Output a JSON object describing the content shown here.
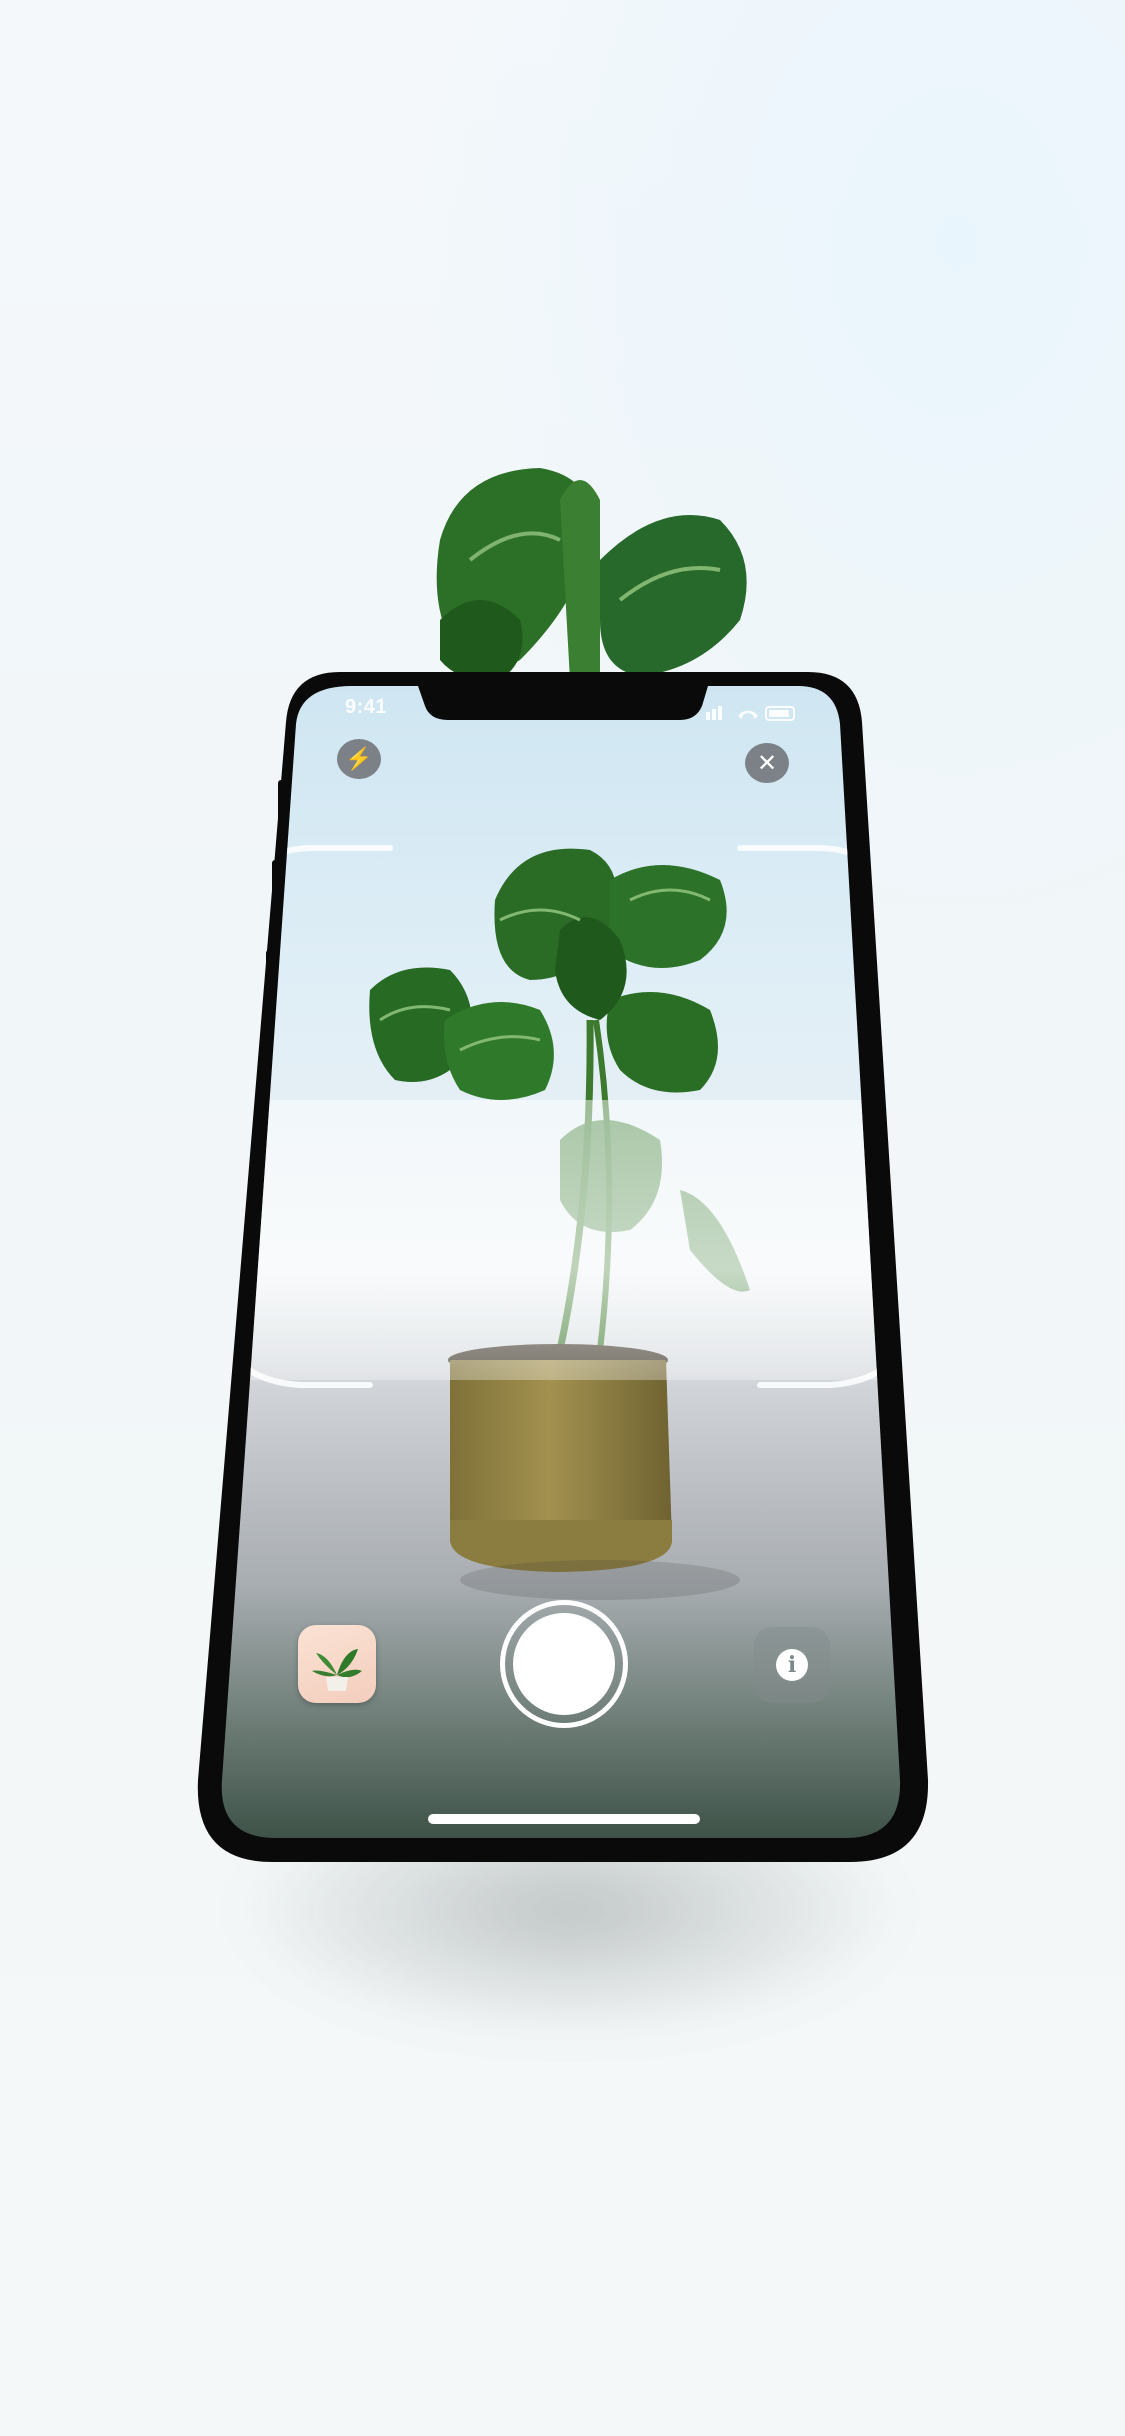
{
  "status_bar": {
    "time": "9:41"
  },
  "camera": {
    "flash_icon": "lightning-bolt-icon",
    "close_icon": "close-x-icon",
    "flash_glyph": "⚡",
    "close_glyph": "✕",
    "info_glyph": "i",
    "gallery_icon": "plant-thumbnail",
    "shutter_icon": "shutter-button"
  },
  "colors": {
    "flash_accent": "#f5c400",
    "leaf_dark": "#1f5a1c",
    "leaf_mid": "#2f7a2a",
    "pot": "#9c8a4a",
    "phone_frame": "#0a0a0a"
  }
}
